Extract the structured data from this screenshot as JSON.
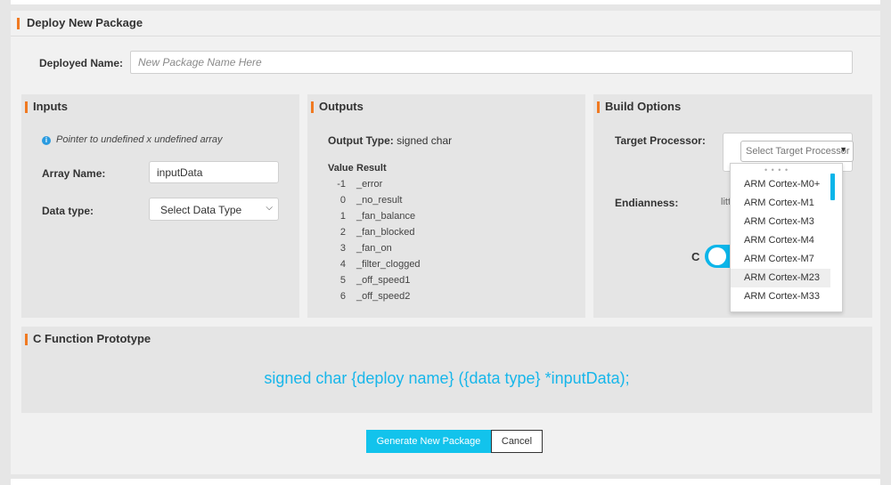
{
  "header": {
    "title": "Deploy New Package"
  },
  "deployed_name": {
    "label": "Deployed Name:",
    "placeholder": "New Package Name Here",
    "value": ""
  },
  "inputs": {
    "title": "Inputs",
    "info": "Pointer to undefined x undefined array",
    "array_name_label": "Array Name:",
    "array_name_value": "inputData",
    "data_type_label": "Data type:",
    "data_type_selected": "Select Data Type"
  },
  "outputs": {
    "title": "Outputs",
    "output_type_label": "Output Type:",
    "output_type_value": "signed char",
    "col_value": "Value",
    "col_result": "Result",
    "rows": [
      {
        "value": "-1",
        "result": "_error"
      },
      {
        "value": "0",
        "result": "_no_result"
      },
      {
        "value": "1",
        "result": "_fan_balance"
      },
      {
        "value": "2",
        "result": "_fan_blocked"
      },
      {
        "value": "3",
        "result": "_fan_on"
      },
      {
        "value": "4",
        "result": "_filter_clogged"
      },
      {
        "value": "5",
        "result": "_off_speed1"
      },
      {
        "value": "6",
        "result": "_off_speed2"
      }
    ]
  },
  "build": {
    "title": "Build Options",
    "target_label": "Target Processor:",
    "target_placeholder": "Select Target Processor",
    "endianness_label": "Endianness:",
    "endianness_value": "litt",
    "language_label": "C",
    "toggle_color": "#0bb5e9",
    "dropdown_options": [
      "ARM Cortex-M0+",
      "ARM Cortex-M1",
      "ARM Cortex-M3",
      "ARM Cortex-M4",
      "ARM Cortex-M7",
      "ARM Cortex-M23",
      "ARM Cortex-M33"
    ],
    "dropdown_hovered": "ARM Cortex-M23"
  },
  "prototype": {
    "title": "C Function Prototype",
    "text": "signed char {deploy name} ({data type} *inputData);",
    "color": "#17b6ea"
  },
  "actions": {
    "generate_label": "Generate New Package",
    "cancel_label": "Cancel",
    "generate_color": "#12c3ec"
  },
  "accent_color": "#f07a22"
}
